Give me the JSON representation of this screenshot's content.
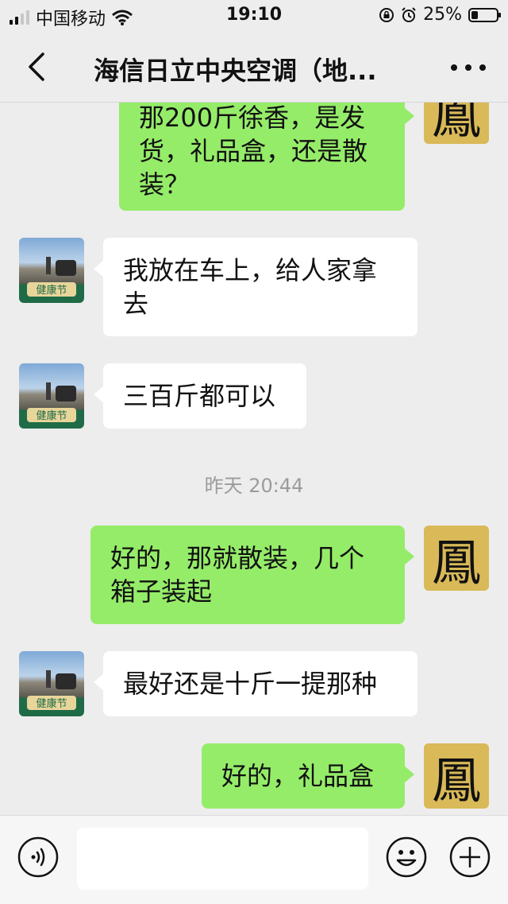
{
  "status_bar": {
    "carrier": "中国移动",
    "time": "19:10",
    "battery": "25%",
    "battery_level": 0.25
  },
  "nav": {
    "title": "海信日立中央空调（地..."
  },
  "messages": [
    {
      "side": "out",
      "text": "那200斤徐香，是发货，礼品盒，还是散装？"
    },
    {
      "side": "in",
      "text": "我放在车上，给人家拿去"
    },
    {
      "side": "in",
      "text": "三百斤都可以"
    },
    {
      "timestamp": "昨天 20:44"
    },
    {
      "side": "out",
      "text": "好的，那就散装，几个箱子装起"
    },
    {
      "side": "in",
      "text": "最好还是十斤一提那种"
    },
    {
      "side": "out",
      "text": "好的，礼品盒"
    }
  ],
  "avatars": {
    "self_glyph": "鳳",
    "other_badge": "健康节"
  },
  "input": {
    "value": ""
  },
  "icons": {
    "back": "chevron-left-icon",
    "more": "more-dots-icon",
    "voice": "voice-icon",
    "emoji": "emoji-icon",
    "plus": "plus-icon"
  },
  "colors": {
    "background": "#ededed",
    "outgoing_bubble": "#95ec69",
    "incoming_bubble": "#ffffff",
    "timestamp": "#9b9b9b"
  }
}
